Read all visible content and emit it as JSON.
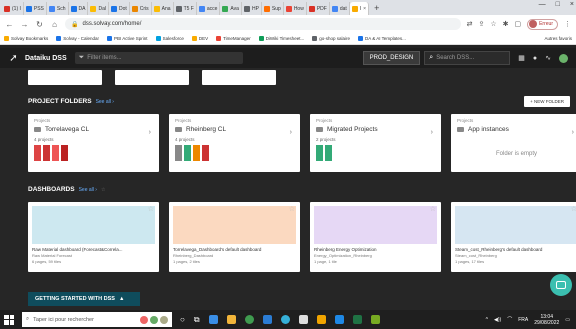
{
  "browser": {
    "tabs": [
      {
        "label": "(1) I",
        "fav": "#d93025"
      },
      {
        "label": "PSS",
        "fav": "#1a73e8"
      },
      {
        "label": "Sch",
        "fav": "#4285f4"
      },
      {
        "label": "DA",
        "fav": "#1a73e8"
      },
      {
        "label": "Dal",
        "fav": "#fbbc04"
      },
      {
        "label": "Dot",
        "fav": "#1a73e8"
      },
      {
        "label": "Cris",
        "fav": "#ea8600"
      },
      {
        "label": "Ana",
        "fav": "#fbbc04"
      },
      {
        "label": "T5 F",
        "fav": "#5f6368"
      },
      {
        "label": "acce",
        "fav": "#4285f4"
      },
      {
        "label": "Ava",
        "fav": "#34a853"
      },
      {
        "label": "HP",
        "fav": "#5f6368"
      },
      {
        "label": "Sup",
        "fav": "#ff6d00"
      },
      {
        "label": "How",
        "fav": "#ea4335"
      },
      {
        "label": "PDF",
        "fav": "#d93025"
      },
      {
        "label": "dat",
        "fav": "#4285f4"
      }
    ],
    "active_tab": {
      "label": "I",
      "close": "×",
      "fav": "#f9ab00"
    },
    "new_tab": "+",
    "window_controls": [
      "—",
      "□",
      "×"
    ],
    "url": "dss.solvay.com/home/",
    "profile_label": "Erreur",
    "bookmarks": [
      {
        "label": "Solvay Bookmarks",
        "color": "#f9ab00"
      },
      {
        "label": "Solvay - Calendar",
        "color": "#1a73e8"
      },
      {
        "label": "PBI Active Sprint",
        "color": "#1a73e8"
      },
      {
        "label": "Salesforce",
        "color": "#00a1e0"
      },
      {
        "label": "DEV",
        "color": "#f9ab00"
      },
      {
        "label": "TimeManager",
        "color": "#ea4335"
      },
      {
        "label": "DiWiki Timesheet...",
        "color": "#0f9d58"
      },
      {
        "label": "go-shop salaire",
        "color": "#5f6368"
      },
      {
        "label": "DA & AI Templates...",
        "color": "#1a73e8"
      }
    ],
    "bookmarks_more": "Autres favoris"
  },
  "dss": {
    "app_title": "Dataiku DSS",
    "filter_placeholder": "Filter items...",
    "instance_label": "PROD_DESIGN",
    "search_placeholder": "Search DSS...",
    "logo_icon": "bird-icon"
  },
  "project_folders": {
    "title": "PROJECT FOLDERS",
    "see_all": "See all ›",
    "new_folder": "+ NEW FOLDER",
    "items": [
      {
        "kicker": "Projects",
        "name": "Torrelavega CL",
        "count": "4 projects",
        "thumbs": [
          "#d44",
          "#c33",
          "#e55",
          "#b22"
        ]
      },
      {
        "kicker": "Projects",
        "name": "Rheinberg CL",
        "count": "4 projects",
        "thumbs": [
          "#888",
          "#3a7",
          "#e80",
          "#c33"
        ]
      },
      {
        "kicker": "Projects",
        "name": "Migrated Projects",
        "count": "2 projects",
        "thumbs": [
          "#3a7",
          "#3a7"
        ]
      },
      {
        "kicker": "Projects",
        "name": "App instances",
        "count": "",
        "empty": "Folder is empty",
        "thumbs": []
      }
    ]
  },
  "dashboards": {
    "title": "DASHBOARDS",
    "see_all": "See all ›",
    "items": [
      {
        "name": "Raw Material dashboard (Forecast&Correla...",
        "sub1": "Raw Material Forecast",
        "sub2": "6 pages, 59 tiles",
        "preview": "#cde8f0"
      },
      {
        "name": "Torrelavega_Dashboard's default dashboard",
        "sub1": "Rheinberg_Dashboard",
        "sub2": "1 pages, 2 tiles",
        "preview": "#fbd9c0"
      },
      {
        "name": "Rheinberg Energy Optimization",
        "sub1": "Energy_Optimization_Rheinberg",
        "sub2": "1 page, 1 tile",
        "preview": "#e6d8f5"
      },
      {
        "name": "Steam_cost_Rheinberg's default dashboard",
        "sub1": "Steam_cost_Rheinberg",
        "sub2": "1 pages, 17 tiles",
        "preview": "#d6e6f2"
      }
    ]
  },
  "getting_started": "GETTING STARTED WITH DSS",
  "taskbar": {
    "search_placeholder": "Taper ici pour rechercher",
    "lang": "FRA",
    "time": "13:04",
    "date": "29/08/2022"
  }
}
